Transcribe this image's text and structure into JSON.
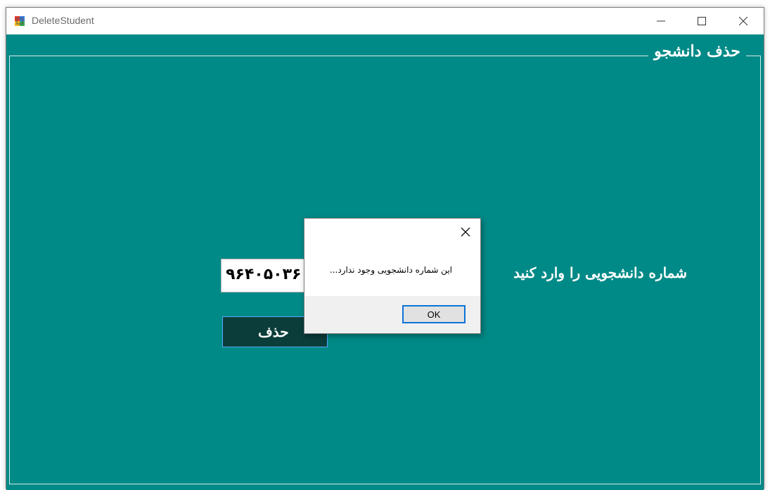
{
  "window": {
    "title": "DeleteStudent",
    "minimize_icon": "minimize-icon",
    "maximize_icon": "maximize-icon",
    "close_icon": "close-icon"
  },
  "form": {
    "group_title": "حذف دانشجو",
    "prompt_label": "شماره دانشجویی را وارد کنید",
    "student_id_value": "۹۶۴۰۵۰۳۶",
    "delete_button_label": "حذف",
    "background_color": "#008a87",
    "button_color": "#0b3d3a"
  },
  "dialog": {
    "message": "این شماره دانشجویی وجود ندارد...",
    "ok_label": "OK",
    "close_icon": "close-icon"
  }
}
